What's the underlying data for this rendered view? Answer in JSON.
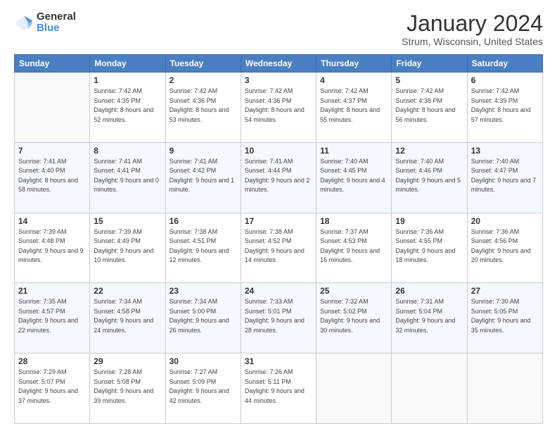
{
  "logo": {
    "general": "General",
    "blue": "Blue"
  },
  "header": {
    "title": "January 2024",
    "subtitle": "Strum, Wisconsin, United States"
  },
  "weekdays": [
    "Sunday",
    "Monday",
    "Tuesday",
    "Wednesday",
    "Thursday",
    "Friday",
    "Saturday"
  ],
  "weeks": [
    [
      {
        "day": "",
        "sunrise": "",
        "sunset": "",
        "daylight": ""
      },
      {
        "day": "1",
        "sunrise": "Sunrise: 7:42 AM",
        "sunset": "Sunset: 4:35 PM",
        "daylight": "Daylight: 8 hours and 52 minutes."
      },
      {
        "day": "2",
        "sunrise": "Sunrise: 7:42 AM",
        "sunset": "Sunset: 4:36 PM",
        "daylight": "Daylight: 8 hours and 53 minutes."
      },
      {
        "day": "3",
        "sunrise": "Sunrise: 7:42 AM",
        "sunset": "Sunset: 4:36 PM",
        "daylight": "Daylight: 8 hours and 54 minutes."
      },
      {
        "day": "4",
        "sunrise": "Sunrise: 7:42 AM",
        "sunset": "Sunset: 4:37 PM",
        "daylight": "Daylight: 8 hours and 55 minutes."
      },
      {
        "day": "5",
        "sunrise": "Sunrise: 7:42 AM",
        "sunset": "Sunset: 4:38 PM",
        "daylight": "Daylight: 8 hours and 56 minutes."
      },
      {
        "day": "6",
        "sunrise": "Sunrise: 7:42 AM",
        "sunset": "Sunset: 4:39 PM",
        "daylight": "Daylight: 8 hours and 57 minutes."
      }
    ],
    [
      {
        "day": "7",
        "sunrise": "Sunrise: 7:41 AM",
        "sunset": "Sunset: 4:40 PM",
        "daylight": "Daylight: 8 hours and 58 minutes."
      },
      {
        "day": "8",
        "sunrise": "Sunrise: 7:41 AM",
        "sunset": "Sunset: 4:41 PM",
        "daylight": "Daylight: 9 hours and 0 minutes."
      },
      {
        "day": "9",
        "sunrise": "Sunrise: 7:41 AM",
        "sunset": "Sunset: 4:42 PM",
        "daylight": "Daylight: 9 hours and 1 minute."
      },
      {
        "day": "10",
        "sunrise": "Sunrise: 7:41 AM",
        "sunset": "Sunset: 4:44 PM",
        "daylight": "Daylight: 9 hours and 2 minutes."
      },
      {
        "day": "11",
        "sunrise": "Sunrise: 7:40 AM",
        "sunset": "Sunset: 4:45 PM",
        "daylight": "Daylight: 9 hours and 4 minutes."
      },
      {
        "day": "12",
        "sunrise": "Sunrise: 7:40 AM",
        "sunset": "Sunset: 4:46 PM",
        "daylight": "Daylight: 9 hours and 5 minutes."
      },
      {
        "day": "13",
        "sunrise": "Sunrise: 7:40 AM",
        "sunset": "Sunset: 4:47 PM",
        "daylight": "Daylight: 9 hours and 7 minutes."
      }
    ],
    [
      {
        "day": "14",
        "sunrise": "Sunrise: 7:39 AM",
        "sunset": "Sunset: 4:48 PM",
        "daylight": "Daylight: 9 hours and 9 minutes."
      },
      {
        "day": "15",
        "sunrise": "Sunrise: 7:39 AM",
        "sunset": "Sunset: 4:49 PM",
        "daylight": "Daylight: 9 hours and 10 minutes."
      },
      {
        "day": "16",
        "sunrise": "Sunrise: 7:38 AM",
        "sunset": "Sunset: 4:51 PM",
        "daylight": "Daylight: 9 hours and 12 minutes."
      },
      {
        "day": "17",
        "sunrise": "Sunrise: 7:38 AM",
        "sunset": "Sunset: 4:52 PM",
        "daylight": "Daylight: 9 hours and 14 minutes."
      },
      {
        "day": "18",
        "sunrise": "Sunrise: 7:37 AM",
        "sunset": "Sunset: 4:53 PM",
        "daylight": "Daylight: 9 hours and 16 minutes."
      },
      {
        "day": "19",
        "sunrise": "Sunrise: 7:36 AM",
        "sunset": "Sunset: 4:55 PM",
        "daylight": "Daylight: 9 hours and 18 minutes."
      },
      {
        "day": "20",
        "sunrise": "Sunrise: 7:36 AM",
        "sunset": "Sunset: 4:56 PM",
        "daylight": "Daylight: 9 hours and 20 minutes."
      }
    ],
    [
      {
        "day": "21",
        "sunrise": "Sunrise: 7:35 AM",
        "sunset": "Sunset: 4:57 PM",
        "daylight": "Daylight: 9 hours and 22 minutes."
      },
      {
        "day": "22",
        "sunrise": "Sunrise: 7:34 AM",
        "sunset": "Sunset: 4:58 PM",
        "daylight": "Daylight: 9 hours and 24 minutes."
      },
      {
        "day": "23",
        "sunrise": "Sunrise: 7:34 AM",
        "sunset": "Sunset: 5:00 PM",
        "daylight": "Daylight: 9 hours and 26 minutes."
      },
      {
        "day": "24",
        "sunrise": "Sunrise: 7:33 AM",
        "sunset": "Sunset: 5:01 PM",
        "daylight": "Daylight: 9 hours and 28 minutes."
      },
      {
        "day": "25",
        "sunrise": "Sunrise: 7:32 AM",
        "sunset": "Sunset: 5:02 PM",
        "daylight": "Daylight: 9 hours and 30 minutes."
      },
      {
        "day": "26",
        "sunrise": "Sunrise: 7:31 AM",
        "sunset": "Sunset: 5:04 PM",
        "daylight": "Daylight: 9 hours and 32 minutes."
      },
      {
        "day": "27",
        "sunrise": "Sunrise: 7:30 AM",
        "sunset": "Sunset: 5:05 PM",
        "daylight": "Daylight: 9 hours and 35 minutes."
      }
    ],
    [
      {
        "day": "28",
        "sunrise": "Sunrise: 7:29 AM",
        "sunset": "Sunset: 5:07 PM",
        "daylight": "Daylight: 9 hours and 37 minutes."
      },
      {
        "day": "29",
        "sunrise": "Sunrise: 7:28 AM",
        "sunset": "Sunset: 5:08 PM",
        "daylight": "Daylight: 9 hours and 39 minutes."
      },
      {
        "day": "30",
        "sunrise": "Sunrise: 7:27 AM",
        "sunset": "Sunset: 5:09 PM",
        "daylight": "Daylight: 9 hours and 42 minutes."
      },
      {
        "day": "31",
        "sunrise": "Sunrise: 7:26 AM",
        "sunset": "Sunset: 5:11 PM",
        "daylight": "Daylight: 9 hours and 44 minutes."
      },
      {
        "day": "",
        "sunrise": "",
        "sunset": "",
        "daylight": ""
      },
      {
        "day": "",
        "sunrise": "",
        "sunset": "",
        "daylight": ""
      },
      {
        "day": "",
        "sunrise": "",
        "sunset": "",
        "daylight": ""
      }
    ]
  ]
}
